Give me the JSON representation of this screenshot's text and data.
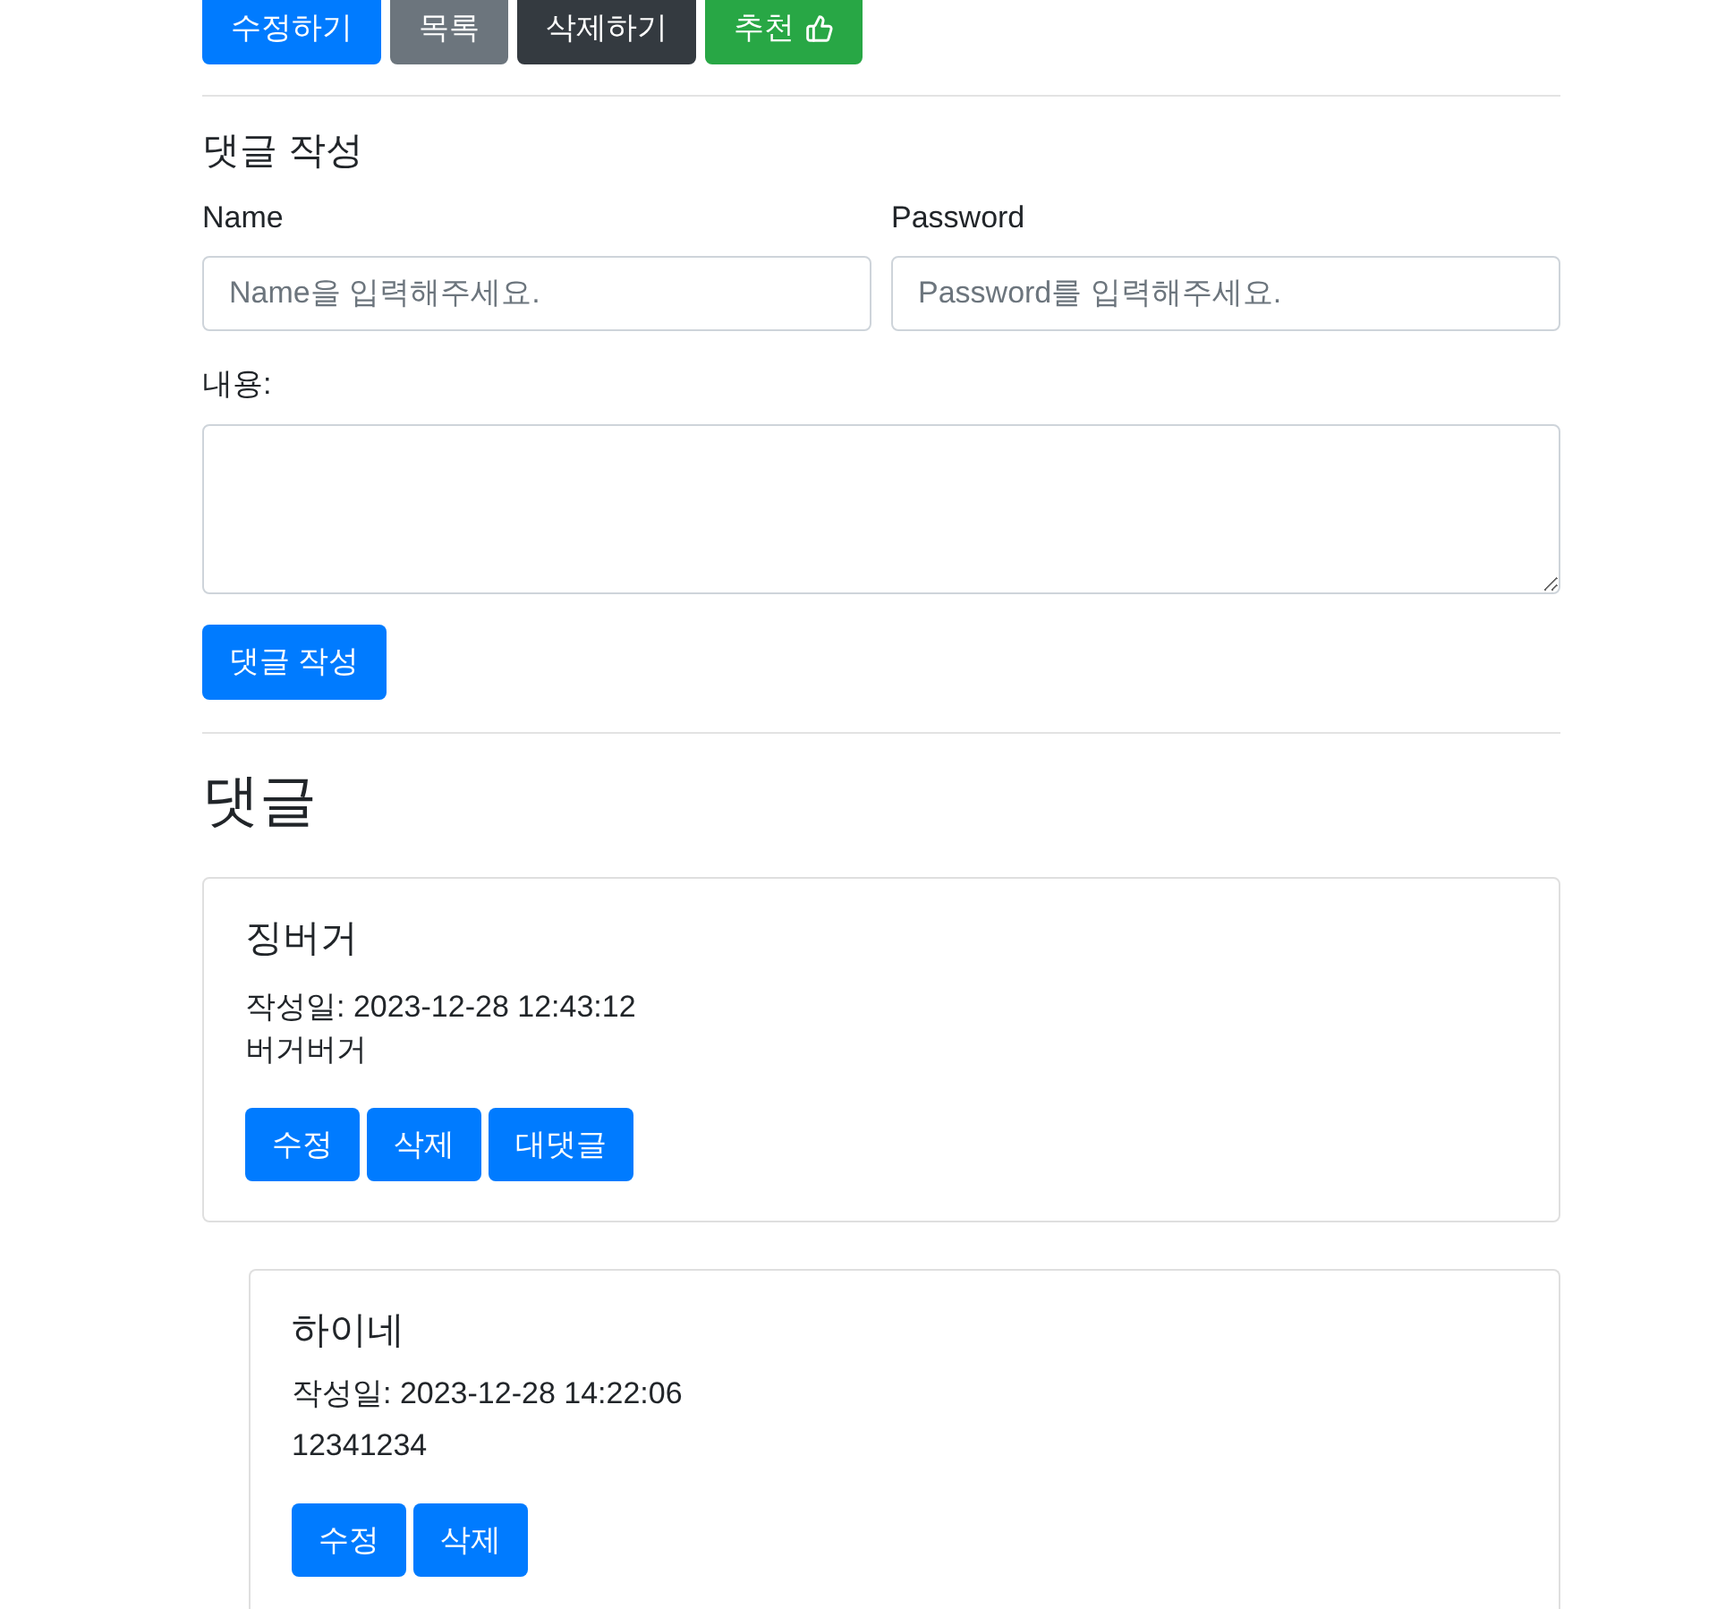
{
  "post_actions": [
    {
      "label": "수정하기",
      "kind": "primary"
    },
    {
      "label": "목록",
      "kind": "secondary"
    },
    {
      "label": "삭제하기",
      "kind": "dark"
    },
    {
      "label": "추천",
      "kind": "like"
    }
  ],
  "comment_form": {
    "title": "댓글 작성",
    "name": {
      "label": "Name",
      "placeholder": "Name을 입력해주세요."
    },
    "password": {
      "label": "Password",
      "placeholder": "Password를 입력해주세요."
    },
    "content": {
      "label": "내용:"
    },
    "submit": "댓글 작성"
  },
  "comments": {
    "title": "댓글",
    "items": [
      {
        "author": "징버거",
        "date": "작성일: 2023-12-28 12:43:12",
        "content": "버거버거",
        "buttons": [
          "수정",
          "삭제",
          "대댓글"
        ],
        "children": [
          {
            "author": "하이네",
            "date": "작성일: 2023-12-28 14:22:06",
            "content": "12341234",
            "buttons": [
              "수정",
              "삭제"
            ]
          }
        ]
      }
    ]
  }
}
